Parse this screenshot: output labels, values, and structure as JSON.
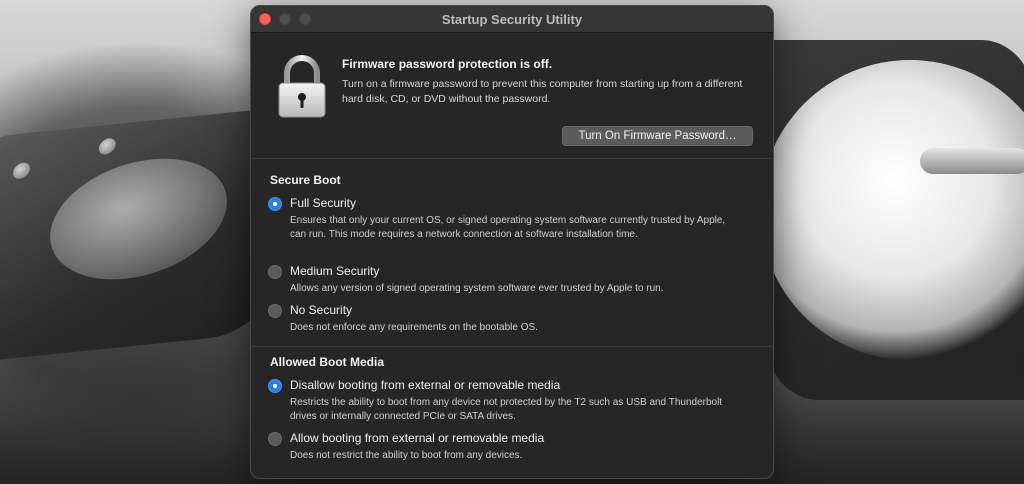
{
  "window": {
    "title": "Startup Security Utility"
  },
  "firmware": {
    "heading": "Firmware password protection is off.",
    "description": "Turn on a firmware password to prevent this computer from starting up from a different hard disk, CD, or DVD without the password.",
    "button_label": "Turn On Firmware Password…",
    "icon": "lock-icon"
  },
  "secure_boot": {
    "heading": "Secure Boot",
    "options": [
      {
        "label": "Full Security",
        "description": "Ensures that only your current OS, or signed operating system software currently trusted by Apple, can run. This mode requires a network connection at software installation time.",
        "selected": true
      },
      {
        "label": "Medium Security",
        "description": "Allows any version of signed operating system software ever trusted by Apple to run.",
        "selected": false
      },
      {
        "label": "No Security",
        "description": "Does not enforce any requirements on the bootable OS.",
        "selected": false
      }
    ]
  },
  "boot_media": {
    "heading": "Allowed Boot Media",
    "options": [
      {
        "label": "Disallow booting from external or removable media",
        "description": "Restricts the ability to boot from any device not protected by the T2 such as USB and Thunderbolt drives or internally connected PCIe or SATA drives.",
        "selected": true
      },
      {
        "label": "Allow booting from external or removable media",
        "description": "Does not restrict the ability to boot from any devices.",
        "selected": false
      }
    ]
  },
  "colors": {
    "accent": "#2f7fe0",
    "window_bg": "#262626",
    "close_button": "#fe5f57"
  }
}
